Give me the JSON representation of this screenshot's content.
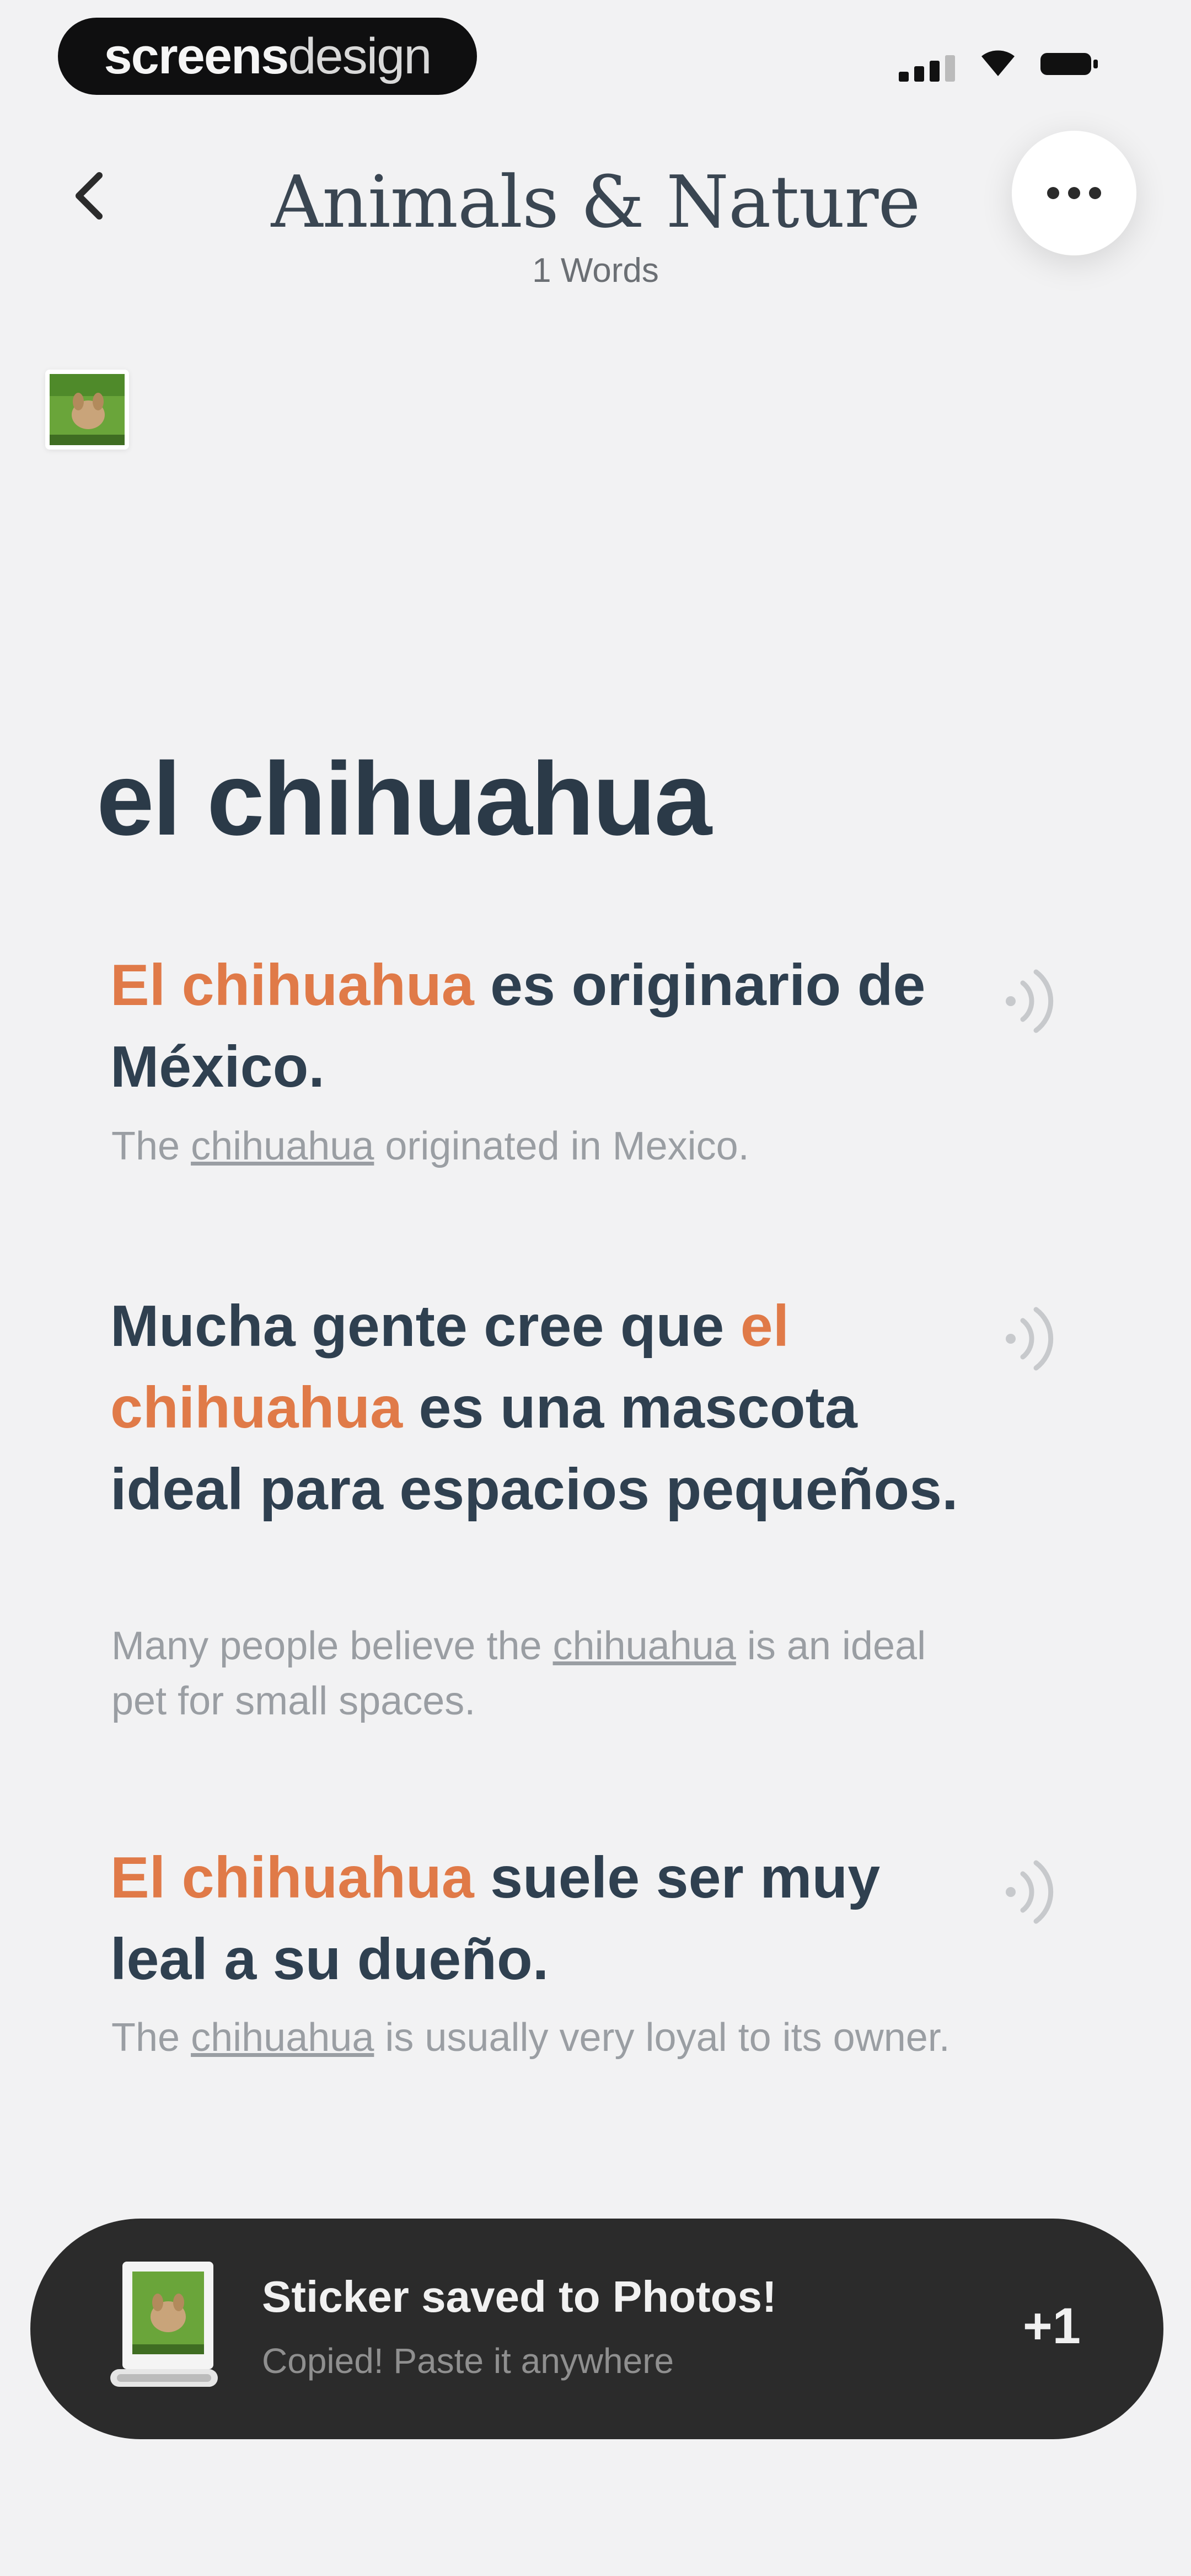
{
  "status_bar": {
    "watermark_bold": "screens",
    "watermark_light": "design"
  },
  "header": {
    "title": "Animals & Nature",
    "subtitle": "1 Words"
  },
  "word": "el chihuahua",
  "examples": [
    {
      "pre": "",
      "highlight": "El chihuahua",
      "post": " es originario de México.",
      "translation_pre": "The ",
      "translation_word": "chihuahua",
      "translation_post": " originated in Mexico."
    },
    {
      "pre": "Mucha gente cree que ",
      "highlight": "el chihuahua",
      "post": " es una mascota ideal para espacios pequeños.",
      "translation_pre": "Many people believe the ",
      "translation_word": "chihuahua",
      "translation_post": " is an ideal pet for small spaces."
    },
    {
      "pre": "",
      "highlight": "El chihuahua",
      "post": " suele ser muy leal a su dueño.",
      "translation_pre": "The ",
      "translation_word": "chihuahua",
      "translation_post": " is usually very loyal to its owner."
    }
  ],
  "toast": {
    "title": "Sticker saved to Photos!",
    "subtitle": "Copied! Paste it anywhere",
    "count": "+1"
  },
  "colors": {
    "accent": "#e07a48",
    "text": "#2f4050",
    "toast_bg": "#2b2b2b"
  },
  "icons": {
    "back": "chevron-left-icon",
    "more": "more-horizontal-icon",
    "speaker": "speaker-icon"
  }
}
